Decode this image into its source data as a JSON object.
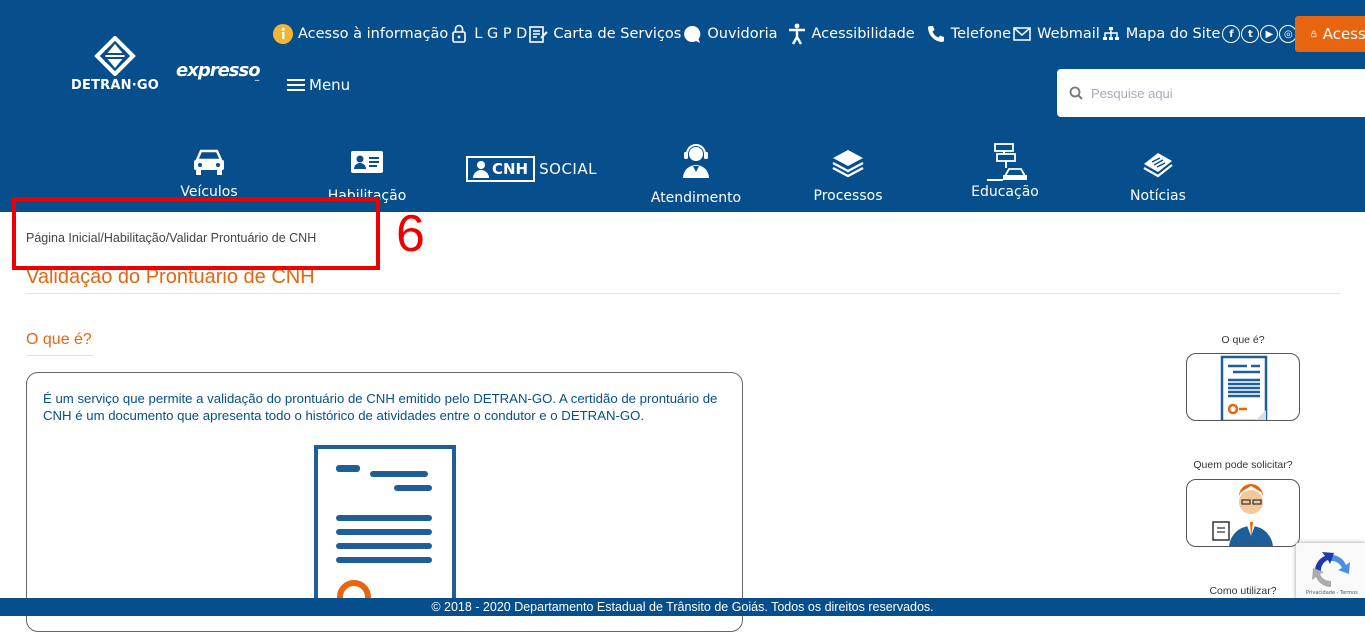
{
  "header": {
    "logo_text": "DETRAN·GO",
    "expresso": "expresso",
    "menu_label": "Menu",
    "top_links": [
      {
        "label": "Acesso à informação",
        "icon": "info-icon"
      },
      {
        "label": "L G P D",
        "icon": "lock-icon"
      },
      {
        "label": "Carta de Serviços",
        "icon": "document-edit-icon"
      },
      {
        "label": "Ouvidoria",
        "icon": "chat-bubble-icon"
      },
      {
        "label": "Acessibilidade",
        "icon": "accessibility-icon"
      },
      {
        "label": "Telefone",
        "icon": "phone-icon"
      },
      {
        "label": "Webmail",
        "icon": "mail-icon"
      },
      {
        "label": "Mapa do Site",
        "icon": "sitemap-icon"
      }
    ],
    "social_icons": [
      "facebook-icon",
      "twitter-icon",
      "youtube-icon",
      "instagram-icon"
    ],
    "acesso_label": "Acesso",
    "search_placeholder": "Pesquise aqui"
  },
  "nav": [
    {
      "label": "Veículos",
      "icon": "car-icon"
    },
    {
      "label": "Habilitação",
      "icon": "id-card-icon"
    },
    {
      "label": "CNH SOCIAL",
      "icon": "cnh-social-logo"
    },
    {
      "label": "Atendimento",
      "icon": "attendant-icon"
    },
    {
      "label": "Processos",
      "icon": "layers-icon"
    },
    {
      "label": "Educação",
      "icon": "traffic-sign-icon"
    },
    {
      "label": "Notícias",
      "icon": "newspaper-icon"
    }
  ],
  "cnh_social": {
    "cnh": "CNH",
    "social": "SOCIAL"
  },
  "breadcrumb": {
    "home": "Página Inicial",
    "sep": "/",
    "section": "Habilitação",
    "current": "Validar Prontuário de CNH"
  },
  "annotation_number": "6",
  "page_title": "Validação do Prontuário de CNH",
  "section_heading": "O que é?",
  "description": "É um serviço que permite a validação do prontuário de CNH emitido pelo DETRAN-GO. A certidão de prontuário de CNH é um documento que apresenta todo o histórico de atividades entre o condutor e o DETRAN-GO.",
  "sidebar": {
    "items": [
      {
        "label": "O que é?",
        "icon": "document-icon"
      },
      {
        "label": "Quem pode solicitar?",
        "icon": "person-icon"
      },
      {
        "label": "Como utilizar?"
      }
    ]
  },
  "recaptcha_text": "Privacidade - Termos",
  "footer": "© 2018 - 2020 Departamento Estadual de Trânsito de Goiás. Todos os direitos reservados.",
  "colors": {
    "primary": "#064f8c",
    "accent": "#e8650f",
    "annotation": "#e00000"
  }
}
